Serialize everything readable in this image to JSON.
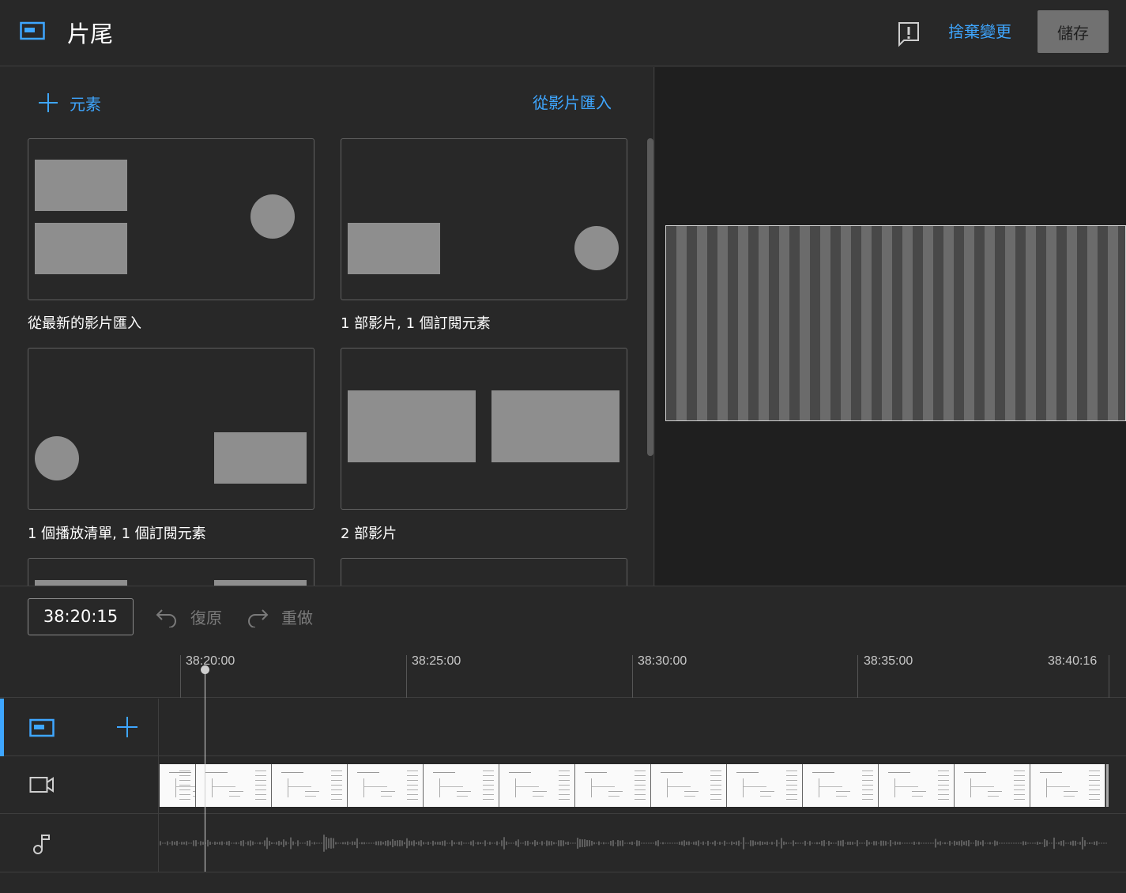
{
  "header": {
    "title": "片尾",
    "discard_label": "捨棄變更",
    "save_label": "儲存"
  },
  "panel": {
    "add_element_label": "元素",
    "import_label": "從影片匯入",
    "templates": [
      {
        "label": "從最新的影片匯入"
      },
      {
        "label": "1 部影片, 1 個訂閱元素"
      },
      {
        "label": "1 個播放清單, 1 個訂閱元素"
      },
      {
        "label": "2 部影片"
      }
    ]
  },
  "toolbar": {
    "timecode": "38:20:15",
    "undo_label": "復原",
    "redo_label": "重做"
  },
  "ruler": {
    "ticks": [
      "38:20:00",
      "38:25:00",
      "38:30:00",
      "38:35:00",
      "38:40:16"
    ]
  },
  "icons": {
    "endscreen": "endscreen-icon",
    "feedback": "feedback-icon",
    "plus": "plus-icon",
    "video": "video-camera-icon",
    "audio": "music-note-icon",
    "undo": "undo-icon",
    "redo": "redo-icon"
  },
  "colors": {
    "accent": "#3ea6ff",
    "background": "#282828",
    "preview_background": "#1f1f1f",
    "save_button": "#717171"
  }
}
